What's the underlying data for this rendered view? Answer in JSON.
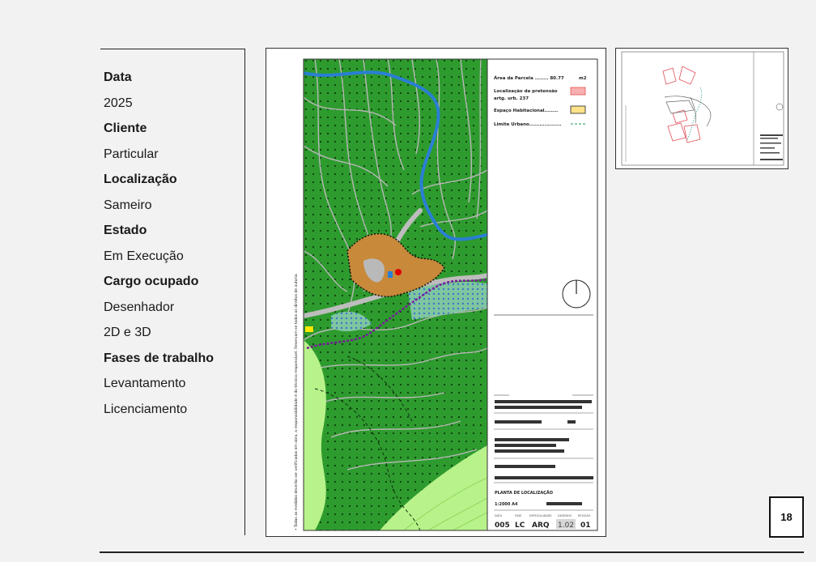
{
  "sidebar": {
    "rows": [
      {
        "text": "Data",
        "kind": "label"
      },
      {
        "text": "2025",
        "kind": "value"
      },
      {
        "text": "Cliente",
        "kind": "label"
      },
      {
        "text": "Particular",
        "kind": "value"
      },
      {
        "text": "Localização",
        "kind": "label"
      },
      {
        "text": "Sameiro",
        "kind": "value"
      },
      {
        "text": "Estado",
        "kind": "label"
      },
      {
        "text": "Em Execução",
        "kind": "value"
      },
      {
        "text": "Cargo ocupado",
        "kind": "label"
      },
      {
        "text": "Desenhador",
        "kind": "value"
      },
      {
        "text": "2D e 3D",
        "kind": "value"
      },
      {
        "text": "Fases de trabalho",
        "kind": "label"
      },
      {
        "text": "Levantamento",
        "kind": "value"
      },
      {
        "text": "Licenciamento",
        "kind": "value"
      }
    ]
  },
  "drawing": {
    "legend": {
      "area_label": "Área da Parcela ........ 80.77",
      "area_unit": "m2",
      "location_label": "Localização da pretensão",
      "location_sub": "artg. urb. 237",
      "habitation_label": "Espaço Habitacional........",
      "urban_limit_label": "Limite Urbano..................."
    },
    "title_block": {
      "drawing_title": "PLANTA DE LOCALIZAÇÃO",
      "scale": "1:2000 A4",
      "codes": [
        "005",
        "LC",
        "ARQ",
        "1.02",
        "01"
      ],
      "headers": [
        "DATA",
        "FASE",
        "ESPECIALIDADE",
        "DESENHO",
        "REVISÃO"
      ]
    },
    "colors": {
      "forest": "#2e9b2e",
      "light_green": "#b8f28a",
      "river": "#2a7fd4",
      "urban": "#c8893a",
      "road": "#b9b9b9",
      "limit": "#7a1aa0"
    }
  },
  "page_number": "18"
}
